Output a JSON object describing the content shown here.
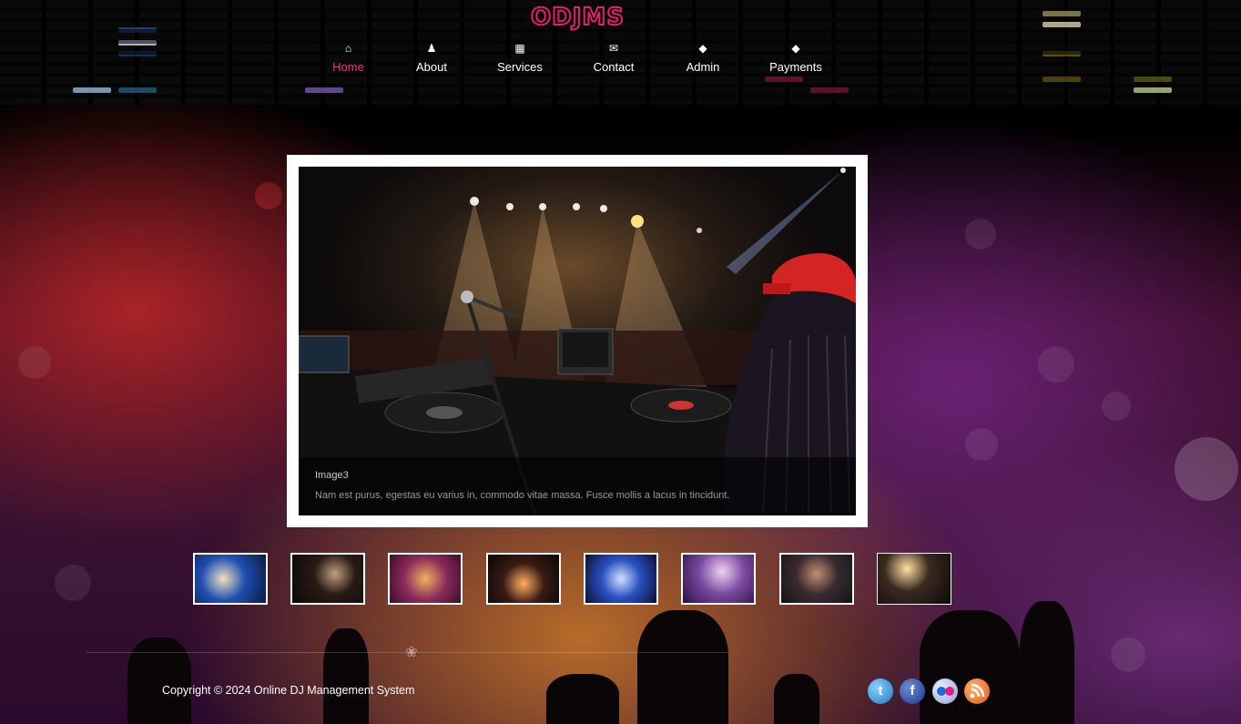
{
  "brand": {
    "logo": "ODJMS",
    "accent": "#e0206d"
  },
  "nav": {
    "items": [
      {
        "label": "Home",
        "icon": "home-icon",
        "active": true
      },
      {
        "label": "About",
        "icon": "user-icon",
        "active": false
      },
      {
        "label": "Services",
        "icon": "calendar-icon",
        "active": false
      },
      {
        "label": "Contact",
        "icon": "envelope-icon",
        "active": false
      },
      {
        "label": "Admin",
        "icon": "tags-icon",
        "active": false
      },
      {
        "label": "Payments",
        "icon": "tags-icon",
        "active": false
      }
    ]
  },
  "slider": {
    "caption_title": "Image3",
    "caption_text": "Nam est purus, egestas eu varius in, commodo vitae massa. Fusce mollis a lacus in tincidunt."
  },
  "thumbnails": [
    {
      "name": "thumb-1"
    },
    {
      "name": "thumb-2"
    },
    {
      "name": "thumb-3"
    },
    {
      "name": "thumb-4"
    },
    {
      "name": "thumb-5"
    },
    {
      "name": "thumb-6"
    },
    {
      "name": "thumb-7"
    },
    {
      "name": "thumb-8"
    }
  ],
  "footer": {
    "copyright": "Copyright © 2024 Online DJ Management System",
    "social": [
      "twitter-icon",
      "facebook-icon",
      "flickr-icon",
      "rss-icon"
    ]
  }
}
